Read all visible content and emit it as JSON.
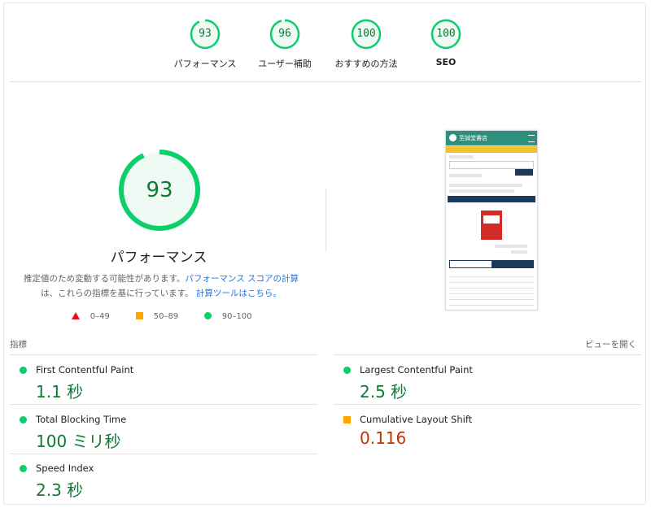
{
  "top_scores": [
    {
      "label": "パフォーマンス",
      "score": "93"
    },
    {
      "label": "ユーザー補助",
      "score": "96"
    },
    {
      "label": "おすすめの方法",
      "score": "100"
    },
    {
      "label": "SEO",
      "score": "100"
    }
  ],
  "main": {
    "score": "93",
    "score_fraction": 0.93,
    "title": "パフォーマンス",
    "desc_1": "推定値のため変動する可能性があります。",
    "desc_link_1": "パフォーマンス スコアの計算",
    "desc_2": "は、これらの指標を基に行っています。",
    "desc_link_2": "計算ツールはこちら。"
  },
  "legend": [
    {
      "range": "0–49",
      "icon": "triangle-red"
    },
    {
      "range": "50–89",
      "icon": "square-orange"
    },
    {
      "range": "90–100",
      "icon": "circle-green"
    }
  ],
  "screenshot": {
    "site_title": "至誠堂書店"
  },
  "metrics_header": {
    "label": "指標",
    "toggle": "ビューを開く"
  },
  "metrics": [
    {
      "name": "First Contentful Paint",
      "value": "1.1 秒",
      "status": "good"
    },
    {
      "name": "Largest Contentful Paint",
      "value": "2.5 秒",
      "status": "good"
    },
    {
      "name": "Total Blocking Time",
      "value": "100 ミリ秒",
      "status": "good"
    },
    {
      "name": "Cumulative Layout Shift",
      "value": "0.116",
      "status": "average"
    },
    {
      "name": "Speed Index",
      "value": "2.3 秒",
      "status": "good"
    }
  ],
  "colors": {
    "good": "#0cce6b",
    "good_text": "#0c7c34",
    "average": "#ffa400",
    "average_text": "#c33300",
    "poor": "#e8110f",
    "link": "#1a73e8"
  }
}
